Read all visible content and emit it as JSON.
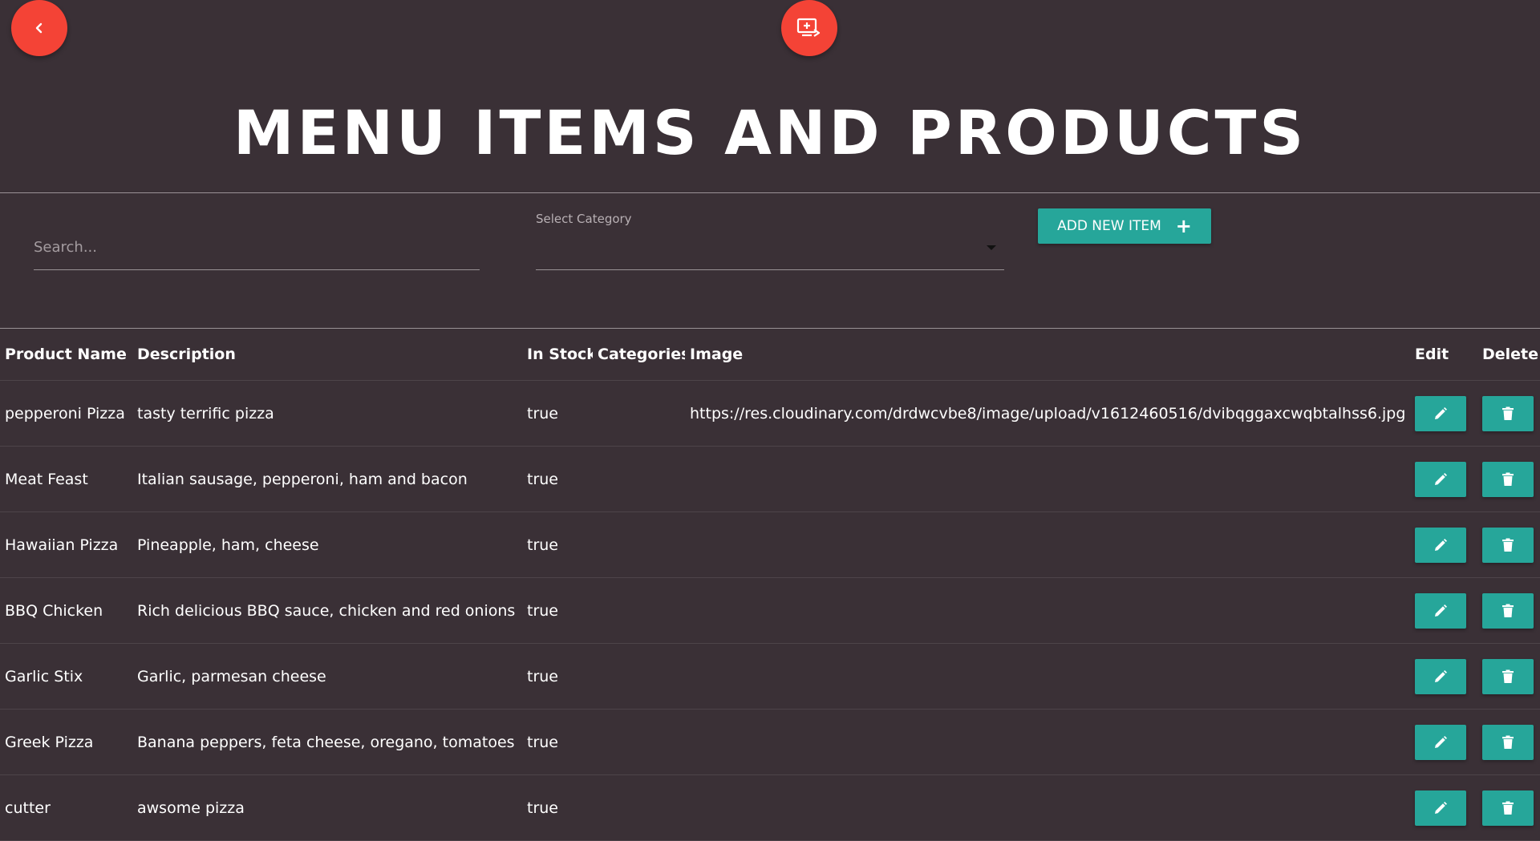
{
  "header": {
    "back_icon": "chevron-left-icon",
    "display_icon": "add-to-screen-icon",
    "title": "MENU ITEMS AND PRODUCTS",
    "fab_color": "#f44336"
  },
  "controls": {
    "search_placeholder": "Search...",
    "search_value": "",
    "category_label": "Select Category",
    "category_value": "",
    "add_button_label": "ADD NEW ITEM",
    "add_button_icon": "plus-icon",
    "accent_color": "#26a69a"
  },
  "table": {
    "columns": {
      "name": "Product Name",
      "description": "Description",
      "in_stock": "In Stock",
      "categories": "Categories",
      "image": "Image",
      "edit": "Edit",
      "delete": "Delete"
    },
    "rows": [
      {
        "name": "pepperoni Pizza",
        "description": "tasty terrific pizza",
        "in_stock": "true",
        "categories": "",
        "image": "https://res.cloudinary.com/drdwcvbe8/image/upload/v1612460516/dvibqggaxcwqbtalhss6.jpg"
      },
      {
        "name": "Meat Feast",
        "description": "Italian sausage, pepperoni, ham and bacon",
        "in_stock": "true",
        "categories": "",
        "image": ""
      },
      {
        "name": "Hawaiian Pizza",
        "description": "Pineapple, ham, cheese",
        "in_stock": "true",
        "categories": "",
        "image": ""
      },
      {
        "name": "BBQ Chicken",
        "description": "Rich delicious BBQ sauce, chicken and red onions",
        "in_stock": "true",
        "categories": "",
        "image": ""
      },
      {
        "name": "Garlic Stix",
        "description": "Garlic, parmesan cheese",
        "in_stock": "true",
        "categories": "",
        "image": ""
      },
      {
        "name": "Greek Pizza",
        "description": "Banana peppers, feta cheese, oregano, tomatoes",
        "in_stock": "true",
        "categories": "",
        "image": ""
      },
      {
        "name": "cutter",
        "description": "awsome pizza",
        "in_stock": "true",
        "categories": "",
        "image": ""
      }
    ],
    "edit_icon": "pencil-icon",
    "delete_icon": "trash-icon"
  }
}
